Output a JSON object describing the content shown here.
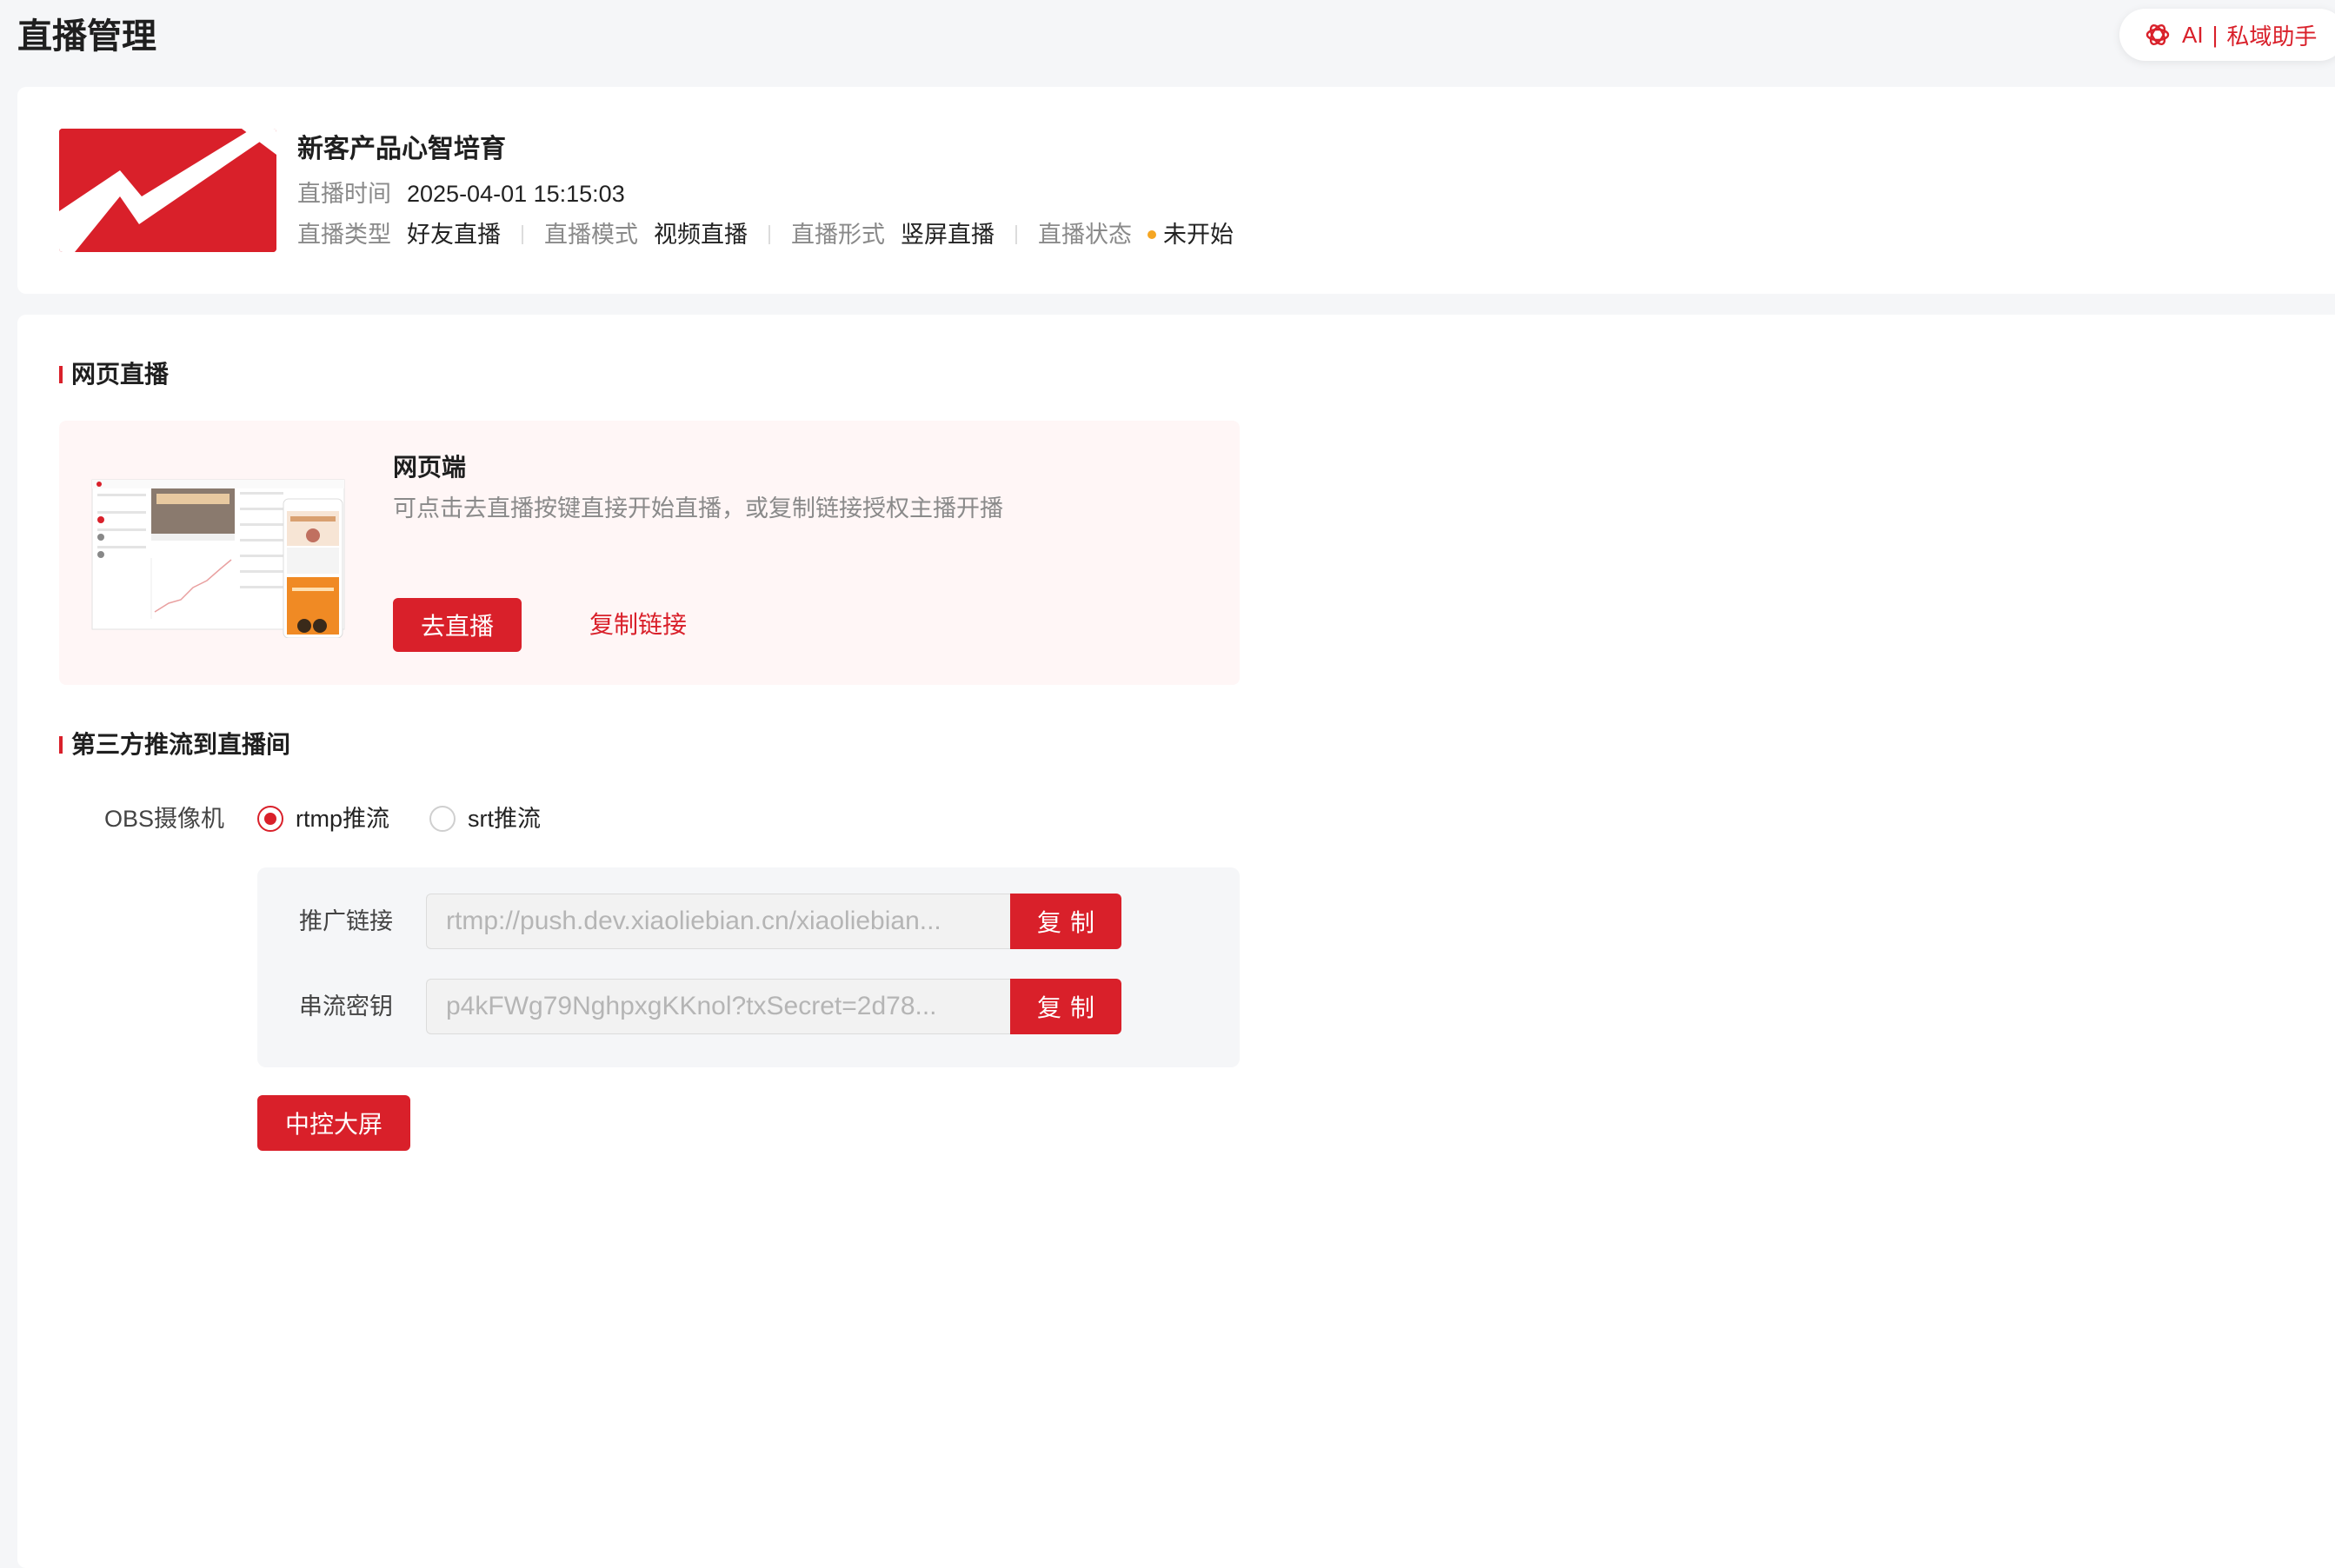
{
  "header": {
    "page_title": "直播管理",
    "ai_pill": {
      "ai_label": "AI",
      "separator": "|",
      "assistant_label": "私域助手",
      "icon": "ai-swirl-icon"
    }
  },
  "live_info": {
    "title": "新客产品心智培育",
    "time_label": "直播时间",
    "time_value": "2025-04-01 15:15:03",
    "type_label": "直播类型",
    "type_value": "好友直播",
    "mode_label": "直播模式",
    "mode_value": "视频直播",
    "form_label": "直播形式",
    "form_value": "竖屏直播",
    "status_label": "直播状态",
    "status_value": "未开始",
    "status_color": "#f5a623"
  },
  "web_live": {
    "section_title": "网页直播",
    "card_title": "网页端",
    "description": "可点击去直播按键直接开始直播，或复制链接授权主播开播",
    "go_live_label": "去直播",
    "copy_link_label": "复制链接"
  },
  "third_party": {
    "section_title": "第三方推流到直播间",
    "camera_label": "OBS摄像机",
    "options": [
      {
        "label": "rtmp推流",
        "selected": true
      },
      {
        "label": "srt推流",
        "selected": false
      }
    ],
    "push_url_label": "推广链接",
    "push_url_value": "rtmp://push.dev.xiaoliebian.cn/xiaoliebian...",
    "stream_key_label": "串流密钥",
    "stream_key_value": "p4kFWg79NghpxgKKnol?txSecret=2d78...",
    "copy_label": "复制",
    "control_screen_label": "中控大屏"
  },
  "colors": {
    "accent": "#d9202a",
    "background": "#f5f6f8",
    "muted_text": "#8a8a8a"
  }
}
